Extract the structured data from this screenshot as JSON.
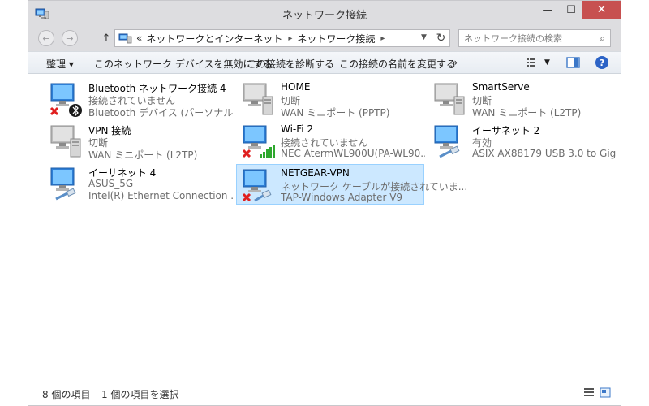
{
  "window": {
    "title": "ネットワーク接続",
    "minimize_glyph": "—",
    "maximize_glyph": "☐",
    "close_glyph": "✕"
  },
  "address": {
    "back_glyph": "←",
    "forward_glyph": "→",
    "up_glyph": "↑",
    "overflow": "«",
    "crumb_1": "ネットワークとインターネット",
    "crumb_2": "ネットワーク接続",
    "search_placeholder": "ネットワーク接続の検索"
  },
  "commands": {
    "organize": "整理 ▾",
    "disable": "このネットワーク デバイスを無効にする",
    "diagnose": "この接続を診断する",
    "rename": "この接続の名前を変更する",
    "more": "»"
  },
  "connections": [
    {
      "name": "Bluetooth ネットワーク接続 4",
      "status": "接続されていません",
      "device": "Bluetooth デバイス (パーソナル エリ...",
      "icon": "network-disconnected-bluetooth-icon",
      "selected": false
    },
    {
      "name": "HOME",
      "status": "切断",
      "device": "WAN ミニポート (PPTP)",
      "icon": "vpn-connection-icon",
      "selected": false
    },
    {
      "name": "SmartServe",
      "status": "切断",
      "device": "WAN ミニポート (L2TP)",
      "icon": "vpn-connection-icon",
      "selected": false
    },
    {
      "name": "VPN 接続",
      "status": "切断",
      "device": "WAN ミニポート (L2TP)",
      "icon": "vpn-connection-icon",
      "selected": false
    },
    {
      "name": "Wi-Fi 2",
      "status": "接続されていません",
      "device": "NEC AtermWL900U(PA-WL90...",
      "icon": "wifi-disconnected-icon",
      "selected": false
    },
    {
      "name": "イーサネット 2",
      "status": "有効",
      "device": "ASIX AX88179 USB 3.0 to Gig...",
      "icon": "ethernet-icon",
      "selected": false
    },
    {
      "name": "イーサネット 4",
      "status": "ASUS_5G",
      "device": "Intel(R) Ethernet Connection ...",
      "icon": "ethernet-icon",
      "selected": false
    },
    {
      "name": "NETGEAR-VPN",
      "status": "ネットワーク ケーブルが接続されていま...",
      "device": "TAP-Windows Adapter V9",
      "icon": "ethernet-disconnected-icon",
      "selected": true
    }
  ],
  "statusbar": {
    "count": "8 個の項目",
    "selected": "1 個の項目を選択"
  },
  "colors": {
    "titlebar": "#dddde0",
    "close": "#c75050",
    "selection": "#cce8ff",
    "selection_border": "#99d1ff",
    "accent": "#2c63c6"
  }
}
